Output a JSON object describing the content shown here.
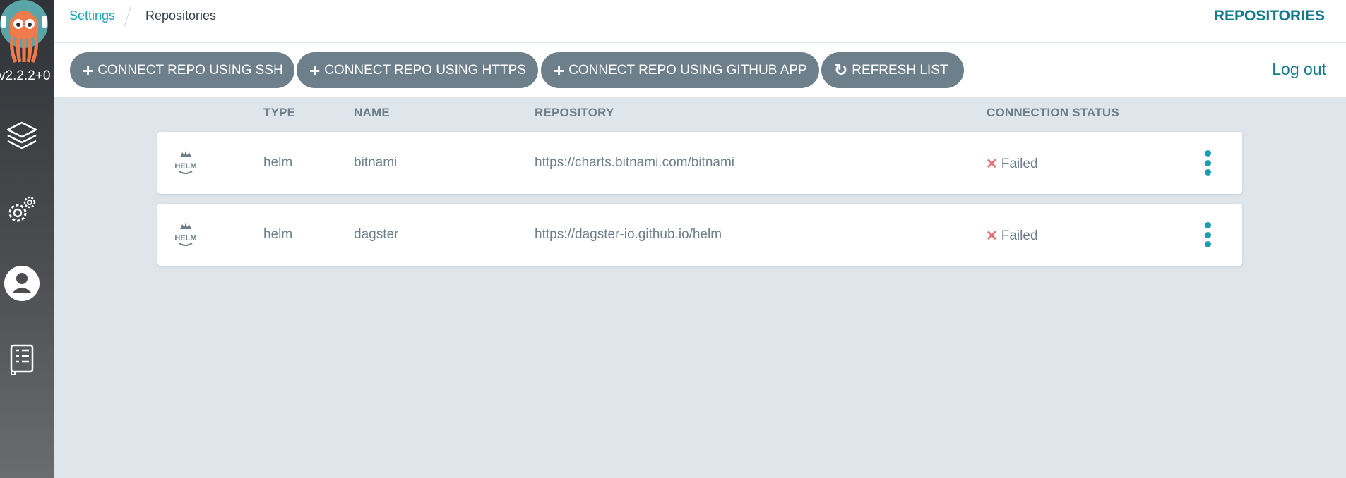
{
  "sidebar": {
    "version": "v2.2.2+0",
    "items": [
      {
        "icon": "layers-icon",
        "name": "applications"
      },
      {
        "icon": "gears-icon",
        "name": "settings"
      },
      {
        "icon": "user-icon",
        "name": "user-info"
      },
      {
        "icon": "docs-icon",
        "name": "documentation"
      }
    ]
  },
  "breadcrumb": {
    "parent": "Settings",
    "current": "Repositories"
  },
  "page_title": "REPOSITORIES",
  "toolbar": {
    "connect_ssh": "CONNECT REPO USING SSH",
    "connect_https": "CONNECT REPO USING HTTPS",
    "connect_github_app": "CONNECT REPO USING GITHUB APP",
    "refresh": "REFRESH LIST",
    "logout": "Log out"
  },
  "table": {
    "columns": {
      "type": "TYPE",
      "name": "NAME",
      "repository": "REPOSITORY",
      "status": "CONNECTION STATUS"
    },
    "rows": [
      {
        "type": "helm",
        "name": "bitnami",
        "repository": "https://charts.bitnami.com/bitnami",
        "status": "Failed"
      },
      {
        "type": "helm",
        "name": "dagster",
        "repository": "https://dagster-io.github.io/helm",
        "status": "Failed"
      }
    ]
  },
  "colors": {
    "accent": "#127a8c",
    "button": "#6d7f8b",
    "failed": "#e96d76",
    "kebab": "#1a9db3"
  }
}
